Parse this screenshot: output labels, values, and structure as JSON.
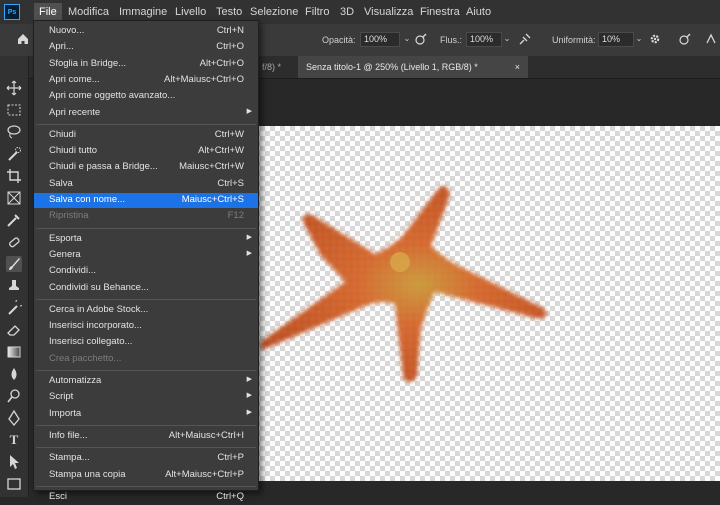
{
  "app": {
    "logo": "Ps"
  },
  "menubar": [
    "File",
    "Modifica",
    "Immagine",
    "Livello",
    "Testo",
    "Selezione",
    "Filtro",
    "3D",
    "Visualizza",
    "Finestra",
    "Aiuto"
  ],
  "options": {
    "opacity_label": "Opacità:",
    "opacity_value": "100%",
    "flow_label": "Flus.:",
    "flow_value": "100%",
    "smoothing_label": "Uniformità:",
    "smoothing_value": "10%"
  },
  "tabs": {
    "inactive": "f/8) *",
    "active": "Senza titolo-1 @ 250% (Livello 1, RGB/8) *",
    "active_close": "×"
  },
  "file_menu": {
    "groups": [
      [
        {
          "label": "Nuovo...",
          "shortcut": "Ctrl+N"
        },
        {
          "label": "Apri...",
          "shortcut": "Ctrl+O"
        },
        {
          "label": "Sfoglia in Bridge...",
          "shortcut": "Alt+Ctrl+O"
        },
        {
          "label": "Apri come...",
          "shortcut": "Alt+Maiusc+Ctrl+O"
        },
        {
          "label": "Apri come oggetto avanzato...",
          "shortcut": ""
        },
        {
          "label": "Apri recente",
          "shortcut": "",
          "submenu": true
        }
      ],
      [
        {
          "label": "Chiudi",
          "shortcut": "Ctrl+W"
        },
        {
          "label": "Chiudi tutto",
          "shortcut": "Alt+Ctrl+W"
        },
        {
          "label": "Chiudi e passa a Bridge...",
          "shortcut": "Maiusc+Ctrl+W"
        },
        {
          "label": "Salva",
          "shortcut": "Ctrl+S"
        },
        {
          "label": "Salva con nome...",
          "shortcut": "Maiusc+Ctrl+S",
          "highlighted": true
        },
        {
          "label": "Ripristina",
          "shortcut": "F12",
          "disabled": true
        }
      ],
      [
        {
          "label": "Esporta",
          "shortcut": "",
          "submenu": true
        },
        {
          "label": "Genera",
          "shortcut": "",
          "submenu": true
        },
        {
          "label": "Condividi...",
          "shortcut": ""
        },
        {
          "label": "Condividi su Behance...",
          "shortcut": ""
        }
      ],
      [
        {
          "label": "Cerca in Adobe Stock...",
          "shortcut": ""
        },
        {
          "label": "Inserisci incorporato...",
          "shortcut": ""
        },
        {
          "label": "Inserisci collegato...",
          "shortcut": ""
        },
        {
          "label": "Crea pacchetto...",
          "shortcut": "",
          "disabled": true
        }
      ],
      [
        {
          "label": "Automatizza",
          "shortcut": "",
          "submenu": true
        },
        {
          "label": "Script",
          "shortcut": "",
          "submenu": true
        },
        {
          "label": "Importa",
          "shortcut": "",
          "submenu": true
        }
      ],
      [
        {
          "label": "Info file...",
          "shortcut": "Alt+Maiusc+Ctrl+I"
        }
      ],
      [
        {
          "label": "Stampa...",
          "shortcut": "Ctrl+P"
        },
        {
          "label": "Stampa una copia",
          "shortcut": "Alt+Maiusc+Ctrl+P"
        }
      ],
      [
        {
          "label": "Esci",
          "shortcut": "Ctrl+Q"
        }
      ]
    ]
  },
  "colors": {
    "highlight": "#1c73e8",
    "starfish": "#d2622a"
  }
}
